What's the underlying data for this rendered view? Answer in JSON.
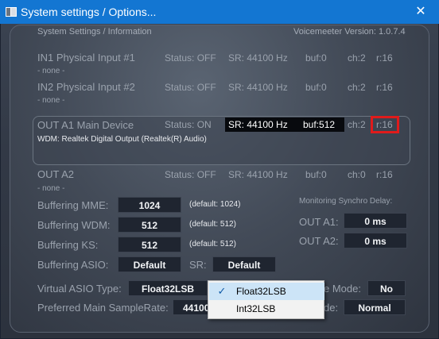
{
  "window": {
    "title": "System settings / Options...",
    "close_glyph": "✕"
  },
  "header": {
    "left": "System Settings / Information",
    "right": "Voicemeeter Version: 1.0.7.4"
  },
  "in1": {
    "name": "IN1 Physical Input #1",
    "device": "- none -",
    "status": "Status: OFF",
    "sr": "SR: 44100 Hz",
    "buf": "buf:0",
    "ch": "ch:2",
    "r": "r:16"
  },
  "in2": {
    "name": "IN2 Physical Input #2",
    "device": "- none -",
    "status": "Status: OFF",
    "sr": "SR: 44100 Hz",
    "buf": "buf:0",
    "ch": "ch:2",
    "r": "r:16"
  },
  "outa1": {
    "name": "OUT A1 Main Device",
    "device": "WDM: Realtek Digital Output (Realtek(R) Audio)",
    "status": "Status: ON",
    "sr": "SR: 44100 Hz",
    "buf": "buf:512",
    "ch": "ch:2",
    "r": "r:16"
  },
  "outa2": {
    "name": "OUT A2",
    "device": "- none -",
    "status": "Status: OFF",
    "sr": "SR: 44100 Hz",
    "buf": "buf:0",
    "ch": "ch:0",
    "r": "r:16"
  },
  "buffering": {
    "mme": {
      "label": "Buffering MME:",
      "value": "1024",
      "default": "(default: 1024)"
    },
    "wdm": {
      "label": "Buffering WDM:",
      "value": "512",
      "default": "(default: 512)"
    },
    "ks": {
      "label": "Buffering KS:",
      "value": "512",
      "default": "(default: 512)"
    },
    "asio": {
      "label": "Buffering ASIO:",
      "value": "Default",
      "sr_label": "SR:",
      "sr_value": "Default"
    }
  },
  "monitoring": {
    "title": "Monitoring Synchro Delay:",
    "a1": {
      "label": "OUT A1:",
      "value": "0 ms"
    },
    "a2": {
      "label": "OUT A2:",
      "value": "0 ms"
    }
  },
  "virtual_asio": {
    "label": "Virtual ASIO Type:",
    "value": "Float32LSB"
  },
  "samplerate": {
    "label": "Preferred Main SampleRate:",
    "value": "44100"
  },
  "right_rows": {
    "mode1": {
      "label": "e Mode:",
      "value": "No"
    },
    "mode2": {
      "label": "de:",
      "value": "Normal"
    }
  },
  "dropdown": {
    "items": [
      {
        "label": "Float32LSB",
        "checked": true
      },
      {
        "label": "Int32LSB",
        "checked": false
      }
    ],
    "check_glyph": "✓"
  }
}
